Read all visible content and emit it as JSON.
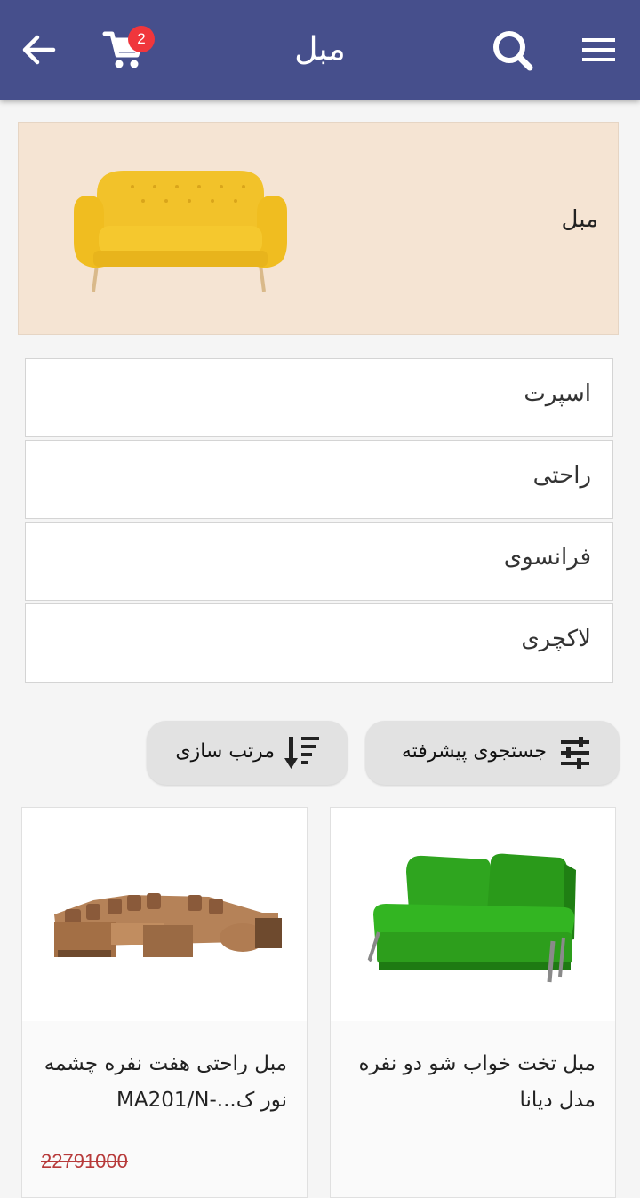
{
  "appbar": {
    "title": "مبل",
    "cart_count": "2",
    "icons": [
      "back-arrow-icon",
      "cart-icon",
      "search-icon",
      "menu-icon"
    ]
  },
  "banner": {
    "label": "مبل"
  },
  "categories": [
    {
      "label": "اسپرت"
    },
    {
      "label": "راحتی"
    },
    {
      "label": "فرانسوی"
    },
    {
      "label": "لاکچری"
    }
  ],
  "actions": {
    "advanced_search": "جستجوی پیشرفته",
    "sort": "مرتب سازی"
  },
  "products": [
    {
      "name": "مبل تخت خواب شو دو نفره مدل دیانا",
      "image": "green-sofa-bed"
    },
    {
      "name": "مبل راحتی هفت نفره چشمه نور ک...-MA201/N",
      "image": "brown-sectional-sofa",
      "old_price": "22791000"
    }
  ],
  "colors": {
    "appbar": "#464f8c",
    "badge": "#f0363c",
    "banner_bg": "#f5e4d3",
    "strike_price": "#b73a3a"
  }
}
